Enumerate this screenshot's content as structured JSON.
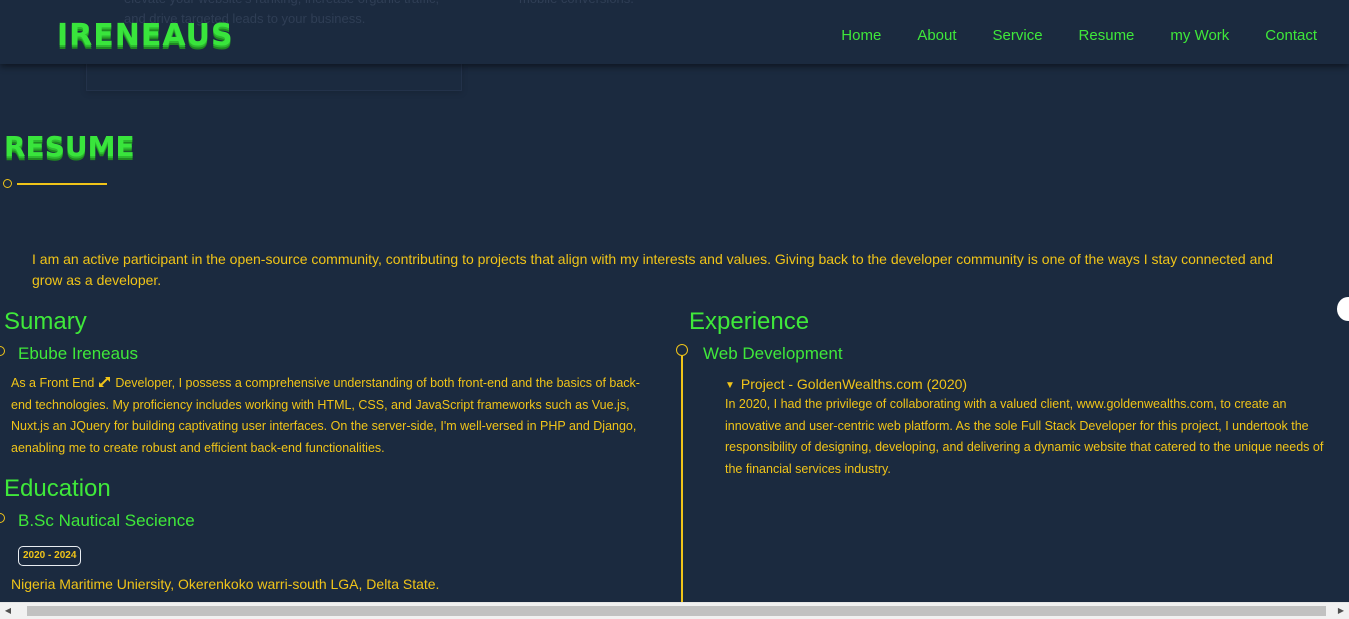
{
  "header": {
    "logo": "IRENEAUS",
    "nav": [
      "Home",
      "About",
      "Service",
      "Resume",
      "my Work",
      "Contact"
    ],
    "ghost_line_1": "elevate your website's ranking, increase organic traffic,",
    "ghost_line_2": "and drive targeted leads to your business.",
    "ghost_right": "mobile conversions."
  },
  "resume": {
    "title": "RESUME",
    "intro": "I am an active participant in the open-source community, contributing to projects that align with my interests and values. Giving back to the developer community is one of the ways I stay connected and grow as a developer."
  },
  "summary": {
    "heading": "Sumary",
    "name": "Ebube Ireneaus",
    "text_before_icon": "As a Front End ",
    "text_after_icon": " Developer, I possess a comprehensive understanding of both front-end and the basics of back-end technologies. My proficiency includes working with HTML, CSS, and JavaScript frameworks such as Vue.js, Nuxt.js an JQuery for building captivating user interfaces. On the server-side, I'm well-versed in PHP and Django, aenabling me to create robust and efficient back-end functionalities."
  },
  "education": {
    "heading": "Education",
    "degree": "B.Sc Nautical Secience",
    "years": "2020 - 2024",
    "school": "Nigeria Maritime Uniersity, Okerenkoko warri-south LGA, Delta State."
  },
  "experience": {
    "heading": "Experience",
    "role": "Web Development",
    "project": "Project - GoldenWealths.com (2020)",
    "text": "In 2020, I had the privilege of collaborating with a valued client, www.goldenwealths.com, to create an innovative and user-centric web platform. As the sole Full Stack Developer for this project, I undertook the responsibility of designing, developing, and delivering a dynamic website that catered to the unique needs of the financial services industry."
  },
  "colors": {
    "background": "#1b2a3f",
    "green": "#3fe83a",
    "gold": "#f0c419"
  },
  "icons": {
    "summary_inline_icon": "expand-arrows-icon",
    "disclosure": "triangle-down-icon"
  }
}
